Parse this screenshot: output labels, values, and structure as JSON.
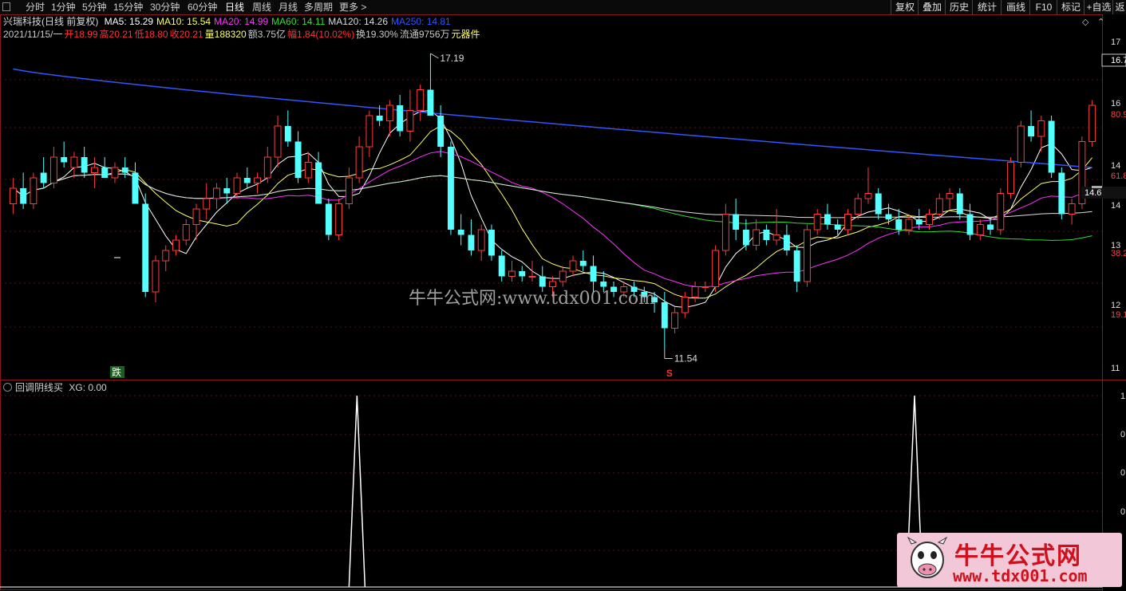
{
  "toolbar": {
    "periods": [
      "分时",
      "1分钟",
      "5分钟",
      "15分钟",
      "30分钟",
      "60分钟",
      "日线",
      "周线",
      "月线",
      "多周期",
      "更多 >"
    ],
    "active_period": "日线",
    "buttons": [
      "复权",
      "叠加",
      "历史",
      "统计",
      "画线",
      "F10",
      "标记",
      "+自选",
      "返"
    ]
  },
  "legend": {
    "title": "兴瑞科技(日线 前复权)",
    "ma": [
      {
        "label": "MA5: 15.29",
        "color": "#ffffff"
      },
      {
        "label": "MA10: 15.54",
        "color": "#ffff66"
      },
      {
        "label": "MA20: 14.99",
        "color": "#ff33ff"
      },
      {
        "label": "MA60: 14.11",
        "color": "#33dd33"
      },
      {
        "label": "MA120: 14.26",
        "color": "#dddddd"
      },
      {
        "label": "MA250: 14.81",
        "color": "#3355ff"
      }
    ],
    "quote": [
      {
        "text": "2021/11/15/一",
        "color": "#c8c8c8"
      },
      {
        "text": "开18.99",
        "color": "#ff3333"
      },
      {
        "text": "高20.21",
        "color": "#ff3333"
      },
      {
        "text": "低18.80",
        "color": "#ff3333"
      },
      {
        "text": "收20.21",
        "color": "#ff3333"
      },
      {
        "text": "量188320",
        "color": "#ffff66"
      },
      {
        "text": "额3.75亿",
        "color": "#c8c8c8"
      },
      {
        "text": "幅1.84(10.02%)",
        "color": "#ff3333"
      },
      {
        "text": "换19.30%",
        "color": "#c8c8c8"
      },
      {
        "text": "流通9756万",
        "color": "#c8c8c8"
      },
      {
        "text": "元器件",
        "color": "#ffff66"
      }
    ]
  },
  "price_axis": {
    "labels": [
      "17",
      "16.74",
      "16",
      "80.9",
      "14",
      "61.8",
      "14.6",
      "14",
      "13",
      "38.2",
      "12",
      "19.1",
      "11"
    ],
    "current_price": "16.74"
  },
  "annotations": {
    "high": "17.19",
    "low": "11.54",
    "signal_sell": "跌",
    "signal_s": "S"
  },
  "sub_chart": {
    "title": "回调阴线买",
    "value_label": "XG: 0.00",
    "axis_labels": [
      "1",
      "0",
      "0",
      "0"
    ]
  },
  "watermark": "牛牛公式网:www.tdx001.com",
  "logo": {
    "title": "牛牛公式网",
    "url": "www.tdx001.com"
  },
  "chart_data": {
    "type": "candlestick",
    "symbol": "兴瑞科技",
    "period": "日线",
    "ylim": [
      11.0,
      17.4
    ],
    "candles": [
      [
        14.3,
        14.8,
        14.1,
        14.6
      ],
      [
        14.6,
        14.9,
        14.2,
        14.3
      ],
      [
        14.3,
        14.9,
        14.2,
        14.8
      ],
      [
        14.9,
        15.2,
        14.6,
        14.7
      ],
      [
        14.7,
        15.4,
        14.6,
        15.2
      ],
      [
        15.2,
        15.5,
        15.0,
        15.1
      ],
      [
        15.0,
        15.3,
        14.8,
        15.2
      ],
      [
        15.2,
        15.4,
        14.8,
        14.9
      ],
      [
        14.9,
        15.2,
        14.6,
        15.0
      ],
      [
        15.0,
        15.2,
        14.8,
        14.8
      ],
      [
        14.8,
        15.1,
        14.7,
        15.0
      ],
      [
        15.0,
        15.2,
        14.8,
        14.9
      ],
      [
        14.9,
        15.1,
        14.3,
        14.3
      ],
      [
        14.3,
        14.5,
        12.5,
        12.6
      ],
      [
        12.6,
        13.3,
        12.4,
        13.2
      ],
      [
        13.2,
        13.5,
        13.0,
        13.4
      ],
      [
        13.4,
        13.7,
        13.3,
        13.6
      ],
      [
        13.6,
        14.0,
        13.5,
        13.9
      ],
      [
        13.9,
        14.3,
        13.6,
        14.2
      ],
      [
        14.2,
        14.7,
        14.0,
        14.4
      ],
      [
        14.4,
        14.7,
        14.2,
        14.6
      ],
      [
        14.6,
        14.8,
        14.3,
        14.5
      ],
      [
        14.5,
        14.9,
        14.4,
        14.8
      ],
      [
        14.8,
        15.0,
        14.6,
        14.7
      ],
      [
        14.7,
        14.9,
        14.5,
        14.8
      ],
      [
        14.8,
        15.4,
        14.7,
        15.2
      ],
      [
        15.2,
        16.0,
        15.0,
        15.8
      ],
      [
        15.8,
        16.1,
        15.4,
        15.5
      ],
      [
        15.5,
        15.7,
        14.7,
        14.8
      ],
      [
        14.8,
        15.3,
        14.7,
        15.1
      ],
      [
        15.1,
        15.3,
        14.3,
        14.3
      ],
      [
        14.3,
        14.4,
        13.6,
        13.7
      ],
      [
        13.7,
        14.4,
        13.6,
        14.3
      ],
      [
        14.3,
        15.0,
        14.2,
        14.8
      ],
      [
        14.8,
        15.6,
        14.7,
        15.4
      ],
      [
        15.4,
        16.1,
        15.2,
        16.0
      ],
      [
        16.0,
        16.2,
        15.8,
        15.9
      ],
      [
        15.9,
        16.3,
        15.6,
        16.2
      ],
      [
        16.2,
        16.4,
        15.6,
        15.7
      ],
      [
        15.7,
        16.5,
        15.5,
        16.1
      ],
      [
        16.1,
        16.6,
        15.9,
        16.5
      ],
      [
        16.5,
        17.2,
        16.3,
        16.0
      ],
      [
        16.0,
        16.2,
        15.2,
        15.4
      ],
      [
        15.4,
        15.5,
        13.7,
        13.8
      ],
      [
        13.8,
        14.1,
        13.5,
        13.7
      ],
      [
        13.7,
        14.0,
        13.3,
        13.4
      ],
      [
        13.4,
        13.9,
        13.2,
        13.8
      ],
      [
        13.8,
        13.9,
        13.2,
        13.3
      ],
      [
        13.3,
        13.4,
        12.8,
        12.9
      ],
      [
        12.9,
        13.2,
        12.8,
        13.0
      ],
      [
        13.0,
        13.1,
        12.8,
        12.9
      ],
      [
        12.9,
        13.2,
        12.8,
        12.9
      ],
      [
        12.9,
        13.1,
        12.6,
        12.7
      ],
      [
        12.7,
        12.9,
        12.5,
        12.8
      ],
      [
        12.8,
        13.1,
        12.7,
        13.0
      ],
      [
        13.0,
        13.3,
        12.9,
        13.2
      ],
      [
        13.2,
        13.4,
        13.0,
        13.1
      ],
      [
        13.1,
        13.3,
        12.6,
        12.8
      ],
      [
        12.8,
        13.0,
        12.6,
        12.7
      ],
      [
        12.7,
        12.8,
        12.5,
        12.6
      ],
      [
        12.6,
        12.8,
        12.5,
        12.7
      ],
      [
        12.7,
        12.8,
        12.5,
        12.6
      ],
      [
        12.6,
        12.7,
        12.4,
        12.5
      ],
      [
        12.5,
        12.6,
        12.2,
        12.4
      ],
      [
        12.4,
        12.6,
        11.5,
        11.9
      ],
      [
        11.9,
        12.3,
        11.8,
        12.2
      ],
      [
        12.2,
        12.6,
        12.1,
        12.5
      ],
      [
        12.5,
        12.8,
        12.4,
        12.7
      ],
      [
        12.7,
        12.8,
        12.6,
        12.7
      ],
      [
        12.7,
        13.5,
        12.6,
        13.4
      ],
      [
        13.4,
        14.3,
        13.3,
        14.1
      ],
      [
        14.1,
        14.4,
        13.6,
        13.8
      ],
      [
        13.8,
        14.0,
        13.4,
        13.5
      ],
      [
        13.5,
        14.0,
        13.4,
        13.8
      ],
      [
        13.8,
        13.9,
        13.5,
        13.6
      ],
      [
        13.6,
        14.2,
        13.5,
        13.7
      ],
      [
        13.7,
        13.9,
        13.3,
        13.4
      ],
      [
        13.4,
        13.5,
        12.6,
        12.8
      ],
      [
        12.8,
        13.9,
        12.7,
        13.8
      ],
      [
        13.8,
        14.2,
        13.7,
        14.1
      ],
      [
        14.1,
        14.3,
        13.8,
        13.9
      ],
      [
        13.9,
        14.0,
        13.7,
        13.8
      ],
      [
        13.8,
        14.2,
        13.7,
        14.1
      ],
      [
        14.1,
        14.5,
        14.0,
        14.4
      ],
      [
        14.4,
        15.0,
        14.3,
        14.5
      ],
      [
        14.5,
        14.6,
        14.0,
        14.1
      ],
      [
        14.1,
        14.3,
        13.9,
        14.0
      ],
      [
        14.0,
        14.2,
        13.7,
        13.8
      ],
      [
        13.8,
        14.1,
        13.7,
        14.0
      ],
      [
        14.0,
        14.2,
        13.8,
        13.9
      ],
      [
        13.9,
        14.2,
        13.8,
        14.1
      ],
      [
        14.1,
        14.5,
        14.0,
        14.4
      ],
      [
        14.4,
        14.6,
        14.2,
        14.5
      ],
      [
        14.5,
        14.6,
        14.0,
        14.1
      ],
      [
        14.1,
        14.3,
        13.6,
        13.7
      ],
      [
        13.7,
        14.0,
        13.6,
        13.9
      ],
      [
        13.9,
        14.0,
        13.7,
        13.8
      ],
      [
        13.8,
        14.6,
        13.7,
        14.5
      ],
      [
        14.5,
        15.2,
        14.4,
        15.1
      ],
      [
        15.1,
        15.9,
        15.0,
        15.8
      ],
      [
        15.8,
        16.1,
        15.5,
        15.6
      ],
      [
        15.6,
        16.0,
        15.3,
        15.9
      ],
      [
        15.9,
        16.0,
        14.8,
        14.9
      ],
      [
        14.9,
        15.0,
        14.0,
        14.1
      ],
      [
        14.1,
        14.4,
        13.9,
        14.3
      ],
      [
        14.3,
        15.6,
        14.2,
        15.5
      ],
      [
        15.5,
        16.3,
        15.4,
        16.2
      ]
    ]
  }
}
